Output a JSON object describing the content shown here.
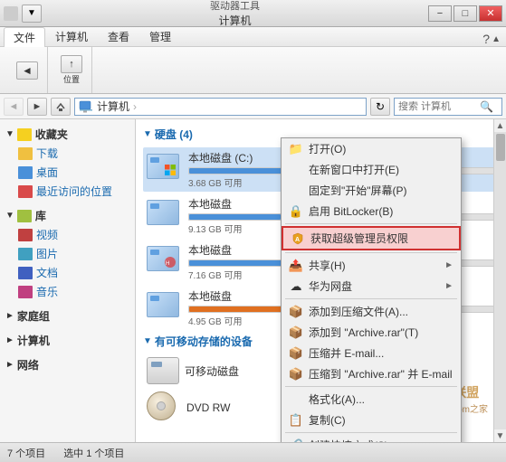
{
  "titlebar": {
    "title": "计算机",
    "tools_label": "驱动器工具",
    "minimize": "−",
    "maximize": "□",
    "close": "✕"
  },
  "ribbon": {
    "tabs": [
      "文件",
      "计算机",
      "查看",
      "管理"
    ],
    "tools_tab": "驱动器工具",
    "help_icon": "?"
  },
  "addressbar": {
    "back": "◄",
    "forward": "►",
    "up": "↑",
    "path": "计算机",
    "refresh": "↻",
    "search_placeholder": "搜索 计算机"
  },
  "sidebar": {
    "favorites_label": "收藏夹",
    "items_favorites": [
      "下载",
      "桌面",
      "最近访问的位置"
    ],
    "library_label": "库",
    "items_library": [
      "视频",
      "图片",
      "文档",
      "音乐"
    ],
    "homegroup_label": "家庭组",
    "computer_label": "计算机",
    "network_label": "网络"
  },
  "drives": {
    "section_title": "硬盘 (4)",
    "items": [
      {
        "name": "本地磁盘 (C:)",
        "used_pct": 55,
        "size": "3.68 GB 可用",
        "has_windows": true
      },
      {
        "name": "本地磁盘",
        "used_pct": 30,
        "size": "9.13 GB 可用",
        "has_windows": false
      },
      {
        "name": "本地磁盘",
        "used_pct": 45,
        "size": "7.16 GB 可用",
        "has_windows": false
      },
      {
        "name": "本地磁盘",
        "used_pct": 60,
        "size": "4.95 GB 可用",
        "has_windows": false,
        "warning": true
      }
    ],
    "removable_section": "有可移动存储的设备",
    "removable_items": [
      "可移动磁盘"
    ],
    "dvd_label": "DVD RW"
  },
  "context_menu": {
    "items": [
      {
        "label": "打开(O)",
        "icon": "",
        "has_arrow": false,
        "highlighted": false
      },
      {
        "label": "在新窗口中打开(E)",
        "icon": "",
        "has_arrow": false,
        "highlighted": false
      },
      {
        "label": "固定到\"开始\"屏幕(P)",
        "icon": "",
        "has_arrow": false,
        "highlighted": false
      },
      {
        "label": "启用 BitLocker(B)",
        "icon": "",
        "has_arrow": false,
        "highlighted": false
      },
      {
        "label": "获取超级管理员权限",
        "icon": "⚙",
        "has_arrow": false,
        "highlighted": true
      },
      {
        "label": "共享(H)",
        "icon": "",
        "has_arrow": true,
        "highlighted": false
      },
      {
        "label": "华为网盘",
        "icon": "",
        "has_arrow": true,
        "highlighted": false
      },
      {
        "label": "添加到压缩文件(A)...",
        "icon": "📦",
        "has_arrow": false,
        "highlighted": false
      },
      {
        "label": "添加到 \"Archive.rar\"(T)",
        "icon": "📦",
        "has_arrow": false,
        "highlighted": false
      },
      {
        "label": "压缩并 E-mail...",
        "icon": "📦",
        "has_arrow": false,
        "highlighted": false
      },
      {
        "label": "压缩到 \"Archive.rar\" 并 E-mail",
        "icon": "📦",
        "has_arrow": false,
        "highlighted": false
      },
      {
        "label": "格式化(A)...",
        "icon": "",
        "has_arrow": false,
        "highlighted": false
      },
      {
        "label": "复制(C)",
        "icon": "",
        "has_arrow": false,
        "highlighted": false
      },
      {
        "label": "创建快捷方式(S)",
        "icon": "",
        "has_arrow": false,
        "highlighted": false
      }
    ]
  },
  "statusbar": {
    "item_count": "7 个项目",
    "selected": "选中 1 个项目"
  },
  "watermark": {
    "line1": "技术员联盟",
    "line2": "www.jsgho.com之家"
  }
}
